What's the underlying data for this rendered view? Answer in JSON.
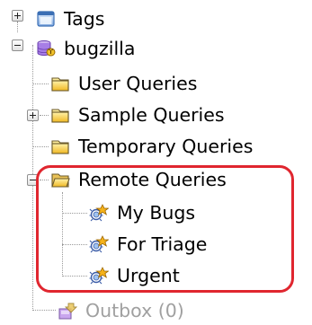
{
  "tree": {
    "tags": {
      "label": "Tags",
      "icon": "window-icon",
      "state": "collapsed"
    },
    "bugzilla": {
      "label": "bugzilla",
      "icon": "database-icon",
      "state": "expanded",
      "children": {
        "user_queries": {
          "label": "User Queries",
          "icon": "folder-icon"
        },
        "sample_queries": {
          "label": "Sample Queries",
          "icon": "folder-icon",
          "state": "collapsed"
        },
        "temporary_queries": {
          "label": "Temporary Queries",
          "icon": "folder-icon"
        },
        "remote_queries": {
          "label": "Remote Queries",
          "icon": "open-folder-icon",
          "state": "expanded",
          "children": [
            {
              "label": "My Bugs",
              "icon": "remote-query-icon"
            },
            {
              "label": "For Triage",
              "icon": "remote-query-icon"
            },
            {
              "label": "Urgent",
              "icon": "remote-query-icon"
            }
          ]
        },
        "outbox": {
          "label": "Outbox (0)",
          "icon": "outbox-icon",
          "disabled": true
        }
      }
    }
  },
  "colors": {
    "highlight": "#e0262f",
    "folder": "#f5c83a",
    "disabled_text": "#a0a0a0"
  }
}
